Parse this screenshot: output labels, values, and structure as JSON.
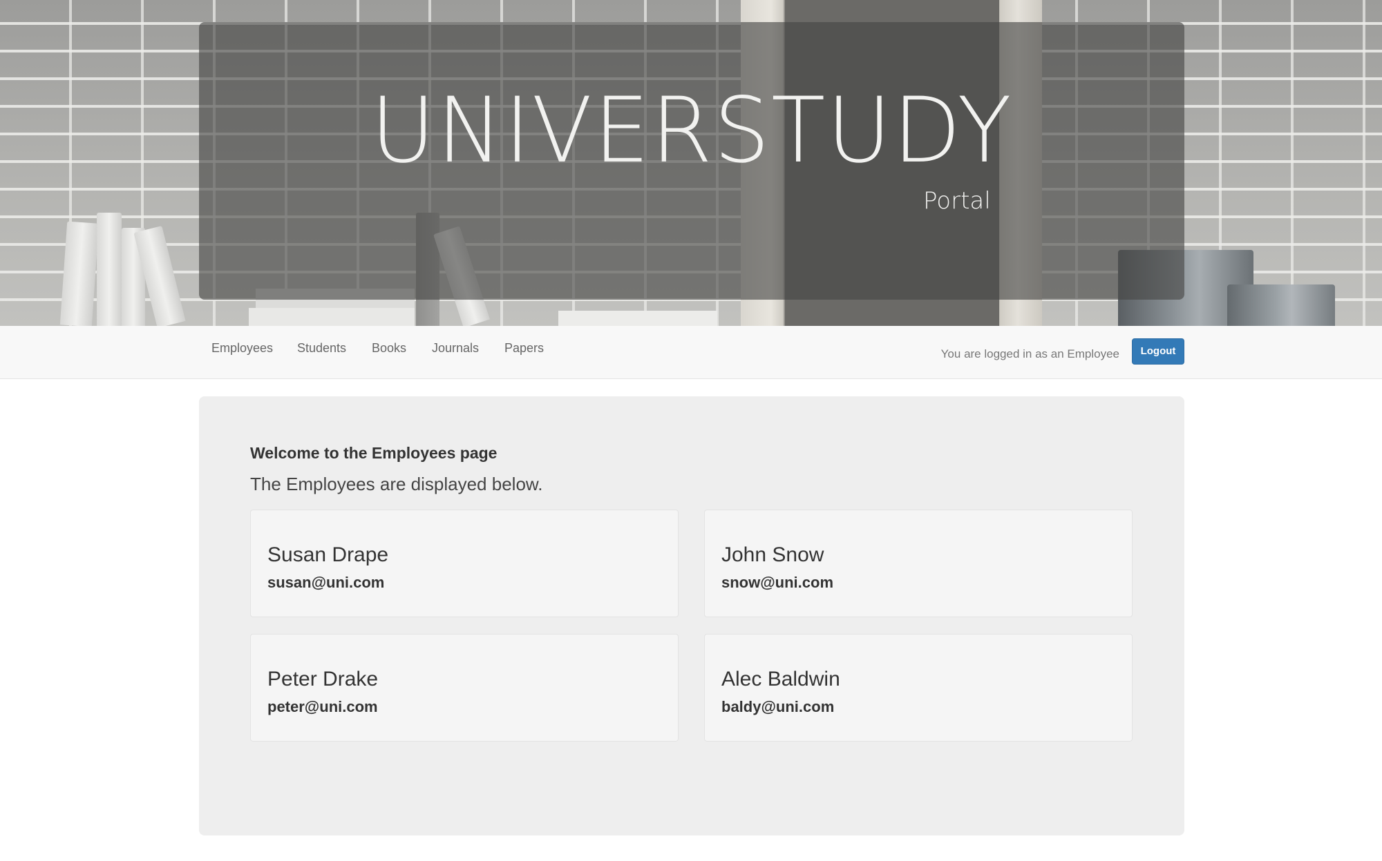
{
  "hero": {
    "title": "UNIVERSTUDY",
    "subtitle": "Portal"
  },
  "nav": {
    "items": [
      {
        "label": "Employees"
      },
      {
        "label": "Students"
      },
      {
        "label": "Books"
      },
      {
        "label": "Journals"
      },
      {
        "label": "Papers"
      }
    ],
    "logged_in_text": "You are logged in as an Employee",
    "logout_label": "Logout"
  },
  "main": {
    "heading": "Welcome to the Employees page",
    "subheading": "The Employees are displayed below.",
    "employees": [
      {
        "name": "Susan Drape",
        "email": "susan@uni.com"
      },
      {
        "name": "John Snow",
        "email": "snow@uni.com"
      },
      {
        "name": "Peter Drake",
        "email": "peter@uni.com"
      },
      {
        "name": "Alec Baldwin",
        "email": "baldy@uni.com"
      }
    ]
  },
  "colors": {
    "primary_button": "#337ab7",
    "panel_background": "#eeeeee",
    "navbar_background": "#f8f8f8"
  }
}
